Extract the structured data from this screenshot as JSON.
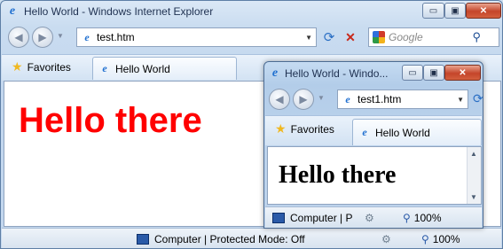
{
  "main": {
    "title": "Hello World - Windows Internet Explorer",
    "address": "test.htm",
    "search_placeholder": "Google",
    "favorites_label": "Favorites",
    "tab_label": "Hello World",
    "heading": "Hello there",
    "heading_color": "#ff0000",
    "status_zone": "Computer | Protected Mode: Off",
    "zoom": "100%"
  },
  "popup": {
    "title": "Hello World - Windo...",
    "address": "test1.htm",
    "favorites_label": "Favorites",
    "tab_label": "Hello World",
    "heading": "Hello there",
    "status_zone": "Computer | P",
    "zoom": "100%"
  },
  "icons": {
    "minimize": "▭",
    "maximize": "▣",
    "close": "✕",
    "back": "◀",
    "forward": "▶",
    "dropdown": "▼",
    "refresh": "⟳",
    "stop": "✕",
    "search": "⚲",
    "star": "★"
  }
}
